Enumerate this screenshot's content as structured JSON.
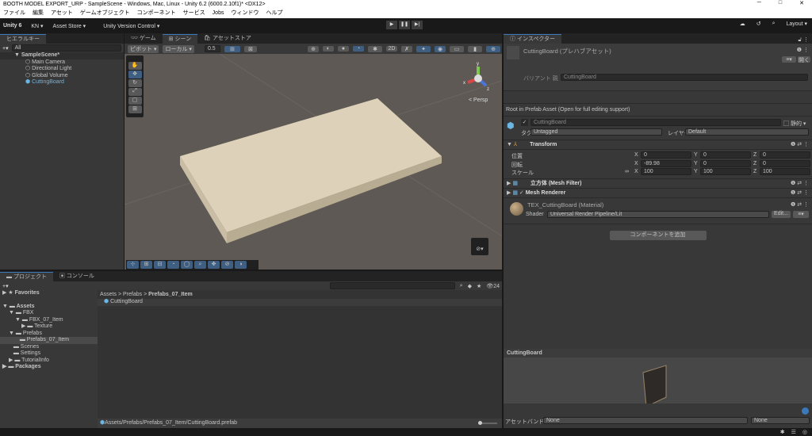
{
  "window": {
    "title": "BOOTH MODEL EXPORT_URP - SampleScene - Windows, Mac, Linux - Unity 6.2 (6000.2.10f1)* <DX12>",
    "controls": [
      "─",
      "□",
      "✕"
    ]
  },
  "menu": [
    "ファイル",
    "編集",
    "アセット",
    "ゲームオブジェクト",
    "コンポーネント",
    "サービス",
    "Jobs",
    "ウィンドウ",
    "ヘルプ"
  ],
  "toolbar": {
    "unity": "Unity 6",
    "account": "KN ▾",
    "asset_store": "Asset Store ▾",
    "version_control": "Unity Version Control ▾",
    "layout": "Layout ▾",
    "play": "▶",
    "pause": "❚❚",
    "step": "▶|"
  },
  "hierarchy": {
    "tab": "ヒエラルキー",
    "search_placeholder": "All",
    "scene": "SampleScene*",
    "items": [
      "Main Camera",
      "Directional Light",
      "Global Volume",
      "CuttingBoard"
    ]
  },
  "scene": {
    "tabs": [
      "ゲーム",
      "シーン",
      "アセットストア"
    ],
    "pivot": "ピボット ▾",
    "local": "ローカル ▾",
    "snap": "0.5",
    "mode_2d": "2D",
    "persp": "< Persp",
    "gizmo_axes": [
      "y",
      "x",
      "z"
    ]
  },
  "inspector": {
    "tab": "インスペクター",
    "asset_title": "CuttingBoard (プレハブアセット)",
    "open": "開く",
    "variant_label": "バリアント 親",
    "variant_value": "CuttingBoard",
    "root_note": "Root in Prefab Asset (Open for full editing support)",
    "name": "CuttingBoard",
    "static": "静的",
    "tag_label": "タグ",
    "tag": "Untagged",
    "layer_label": "レイヤー",
    "layer": "Default",
    "transform": {
      "title": "Transform",
      "rows": [
        {
          "label": "位置",
          "x": "0",
          "y": "0",
          "z": "0"
        },
        {
          "label": "回転",
          "x": "-89.98",
          "y": "0",
          "z": "0"
        },
        {
          "label": "スケール",
          "x": "100",
          "y": "100",
          "z": "100"
        }
      ]
    },
    "mesh_filter": "立方体 (Mesh Filter)",
    "mesh_renderer": "Mesh Renderer",
    "material": "TEX_CuttingBoard (Material)",
    "shader_label": "Shader",
    "shader": "Universal Render Pipeline/Lit",
    "edit": "Edit...",
    "add_component": "コンポーネントを追加",
    "preview_title": "CuttingBoard",
    "bundle_label": "アセットバンドル",
    "bundle": "None",
    "bundle_variant": "None"
  },
  "project": {
    "tabs": [
      "プロジェクト",
      "コンソール"
    ],
    "count": "24",
    "favorites": "Favorites",
    "tree": [
      {
        "label": "Assets",
        "depth": 0,
        "arrow": "▼",
        "bold": true
      },
      {
        "label": "FBX",
        "depth": 1,
        "arrow": "▼"
      },
      {
        "label": "FBX_07_Item",
        "depth": 2,
        "arrow": "▼"
      },
      {
        "label": "Texture",
        "depth": 3,
        "arrow": "▶"
      },
      {
        "label": "Prefabs",
        "depth": 1,
        "arrow": "▼"
      },
      {
        "label": "Prefabs_07_Item",
        "depth": 2,
        "arrow": "",
        "selected": true
      },
      {
        "label": "Scenes",
        "depth": 1,
        "arrow": ""
      },
      {
        "label": "Settings",
        "depth": 1,
        "arrow": ""
      },
      {
        "label": "TutorialInfo",
        "depth": 1,
        "arrow": "▶"
      },
      {
        "label": "Packages",
        "depth": 0,
        "arrow": "▶",
        "bold": true
      }
    ],
    "breadcrumb": [
      "Assets",
      "Prefabs",
      "Prefabs_07_Item"
    ],
    "file": "CuttingBoard",
    "path": "Assets/Prefabs/Prefabs_07_Item/CuttingBoard.prefab"
  }
}
